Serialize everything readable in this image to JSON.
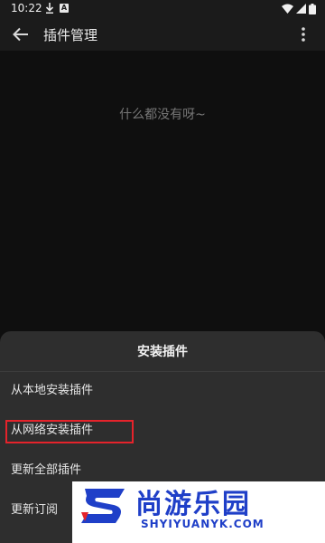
{
  "status_bar": {
    "time": "10:22",
    "icons": [
      "download-icon",
      "a-badge-icon",
      "wifi-icon",
      "signal-icon",
      "battery-icon"
    ]
  },
  "app_bar": {
    "title": "插件管理",
    "back_icon": "arrow-left-icon",
    "menu_icon": "more-vertical-icon"
  },
  "main": {
    "empty_text": "什么都没有呀~"
  },
  "sheet": {
    "title": "安装插件",
    "items": [
      {
        "label": "从本地安装插件"
      },
      {
        "label": "从网络安装插件"
      },
      {
        "label": "更新全部插件"
      },
      {
        "label": "更新订阅"
      }
    ]
  },
  "watermark": {
    "name": "尚游乐园",
    "domain": "SHYIYUANYK.COM"
  },
  "colors": {
    "background": "#141414",
    "sheet": "#2e2e2e",
    "highlight": "#e5232b",
    "watermark_blue": "#1f3fc8"
  }
}
